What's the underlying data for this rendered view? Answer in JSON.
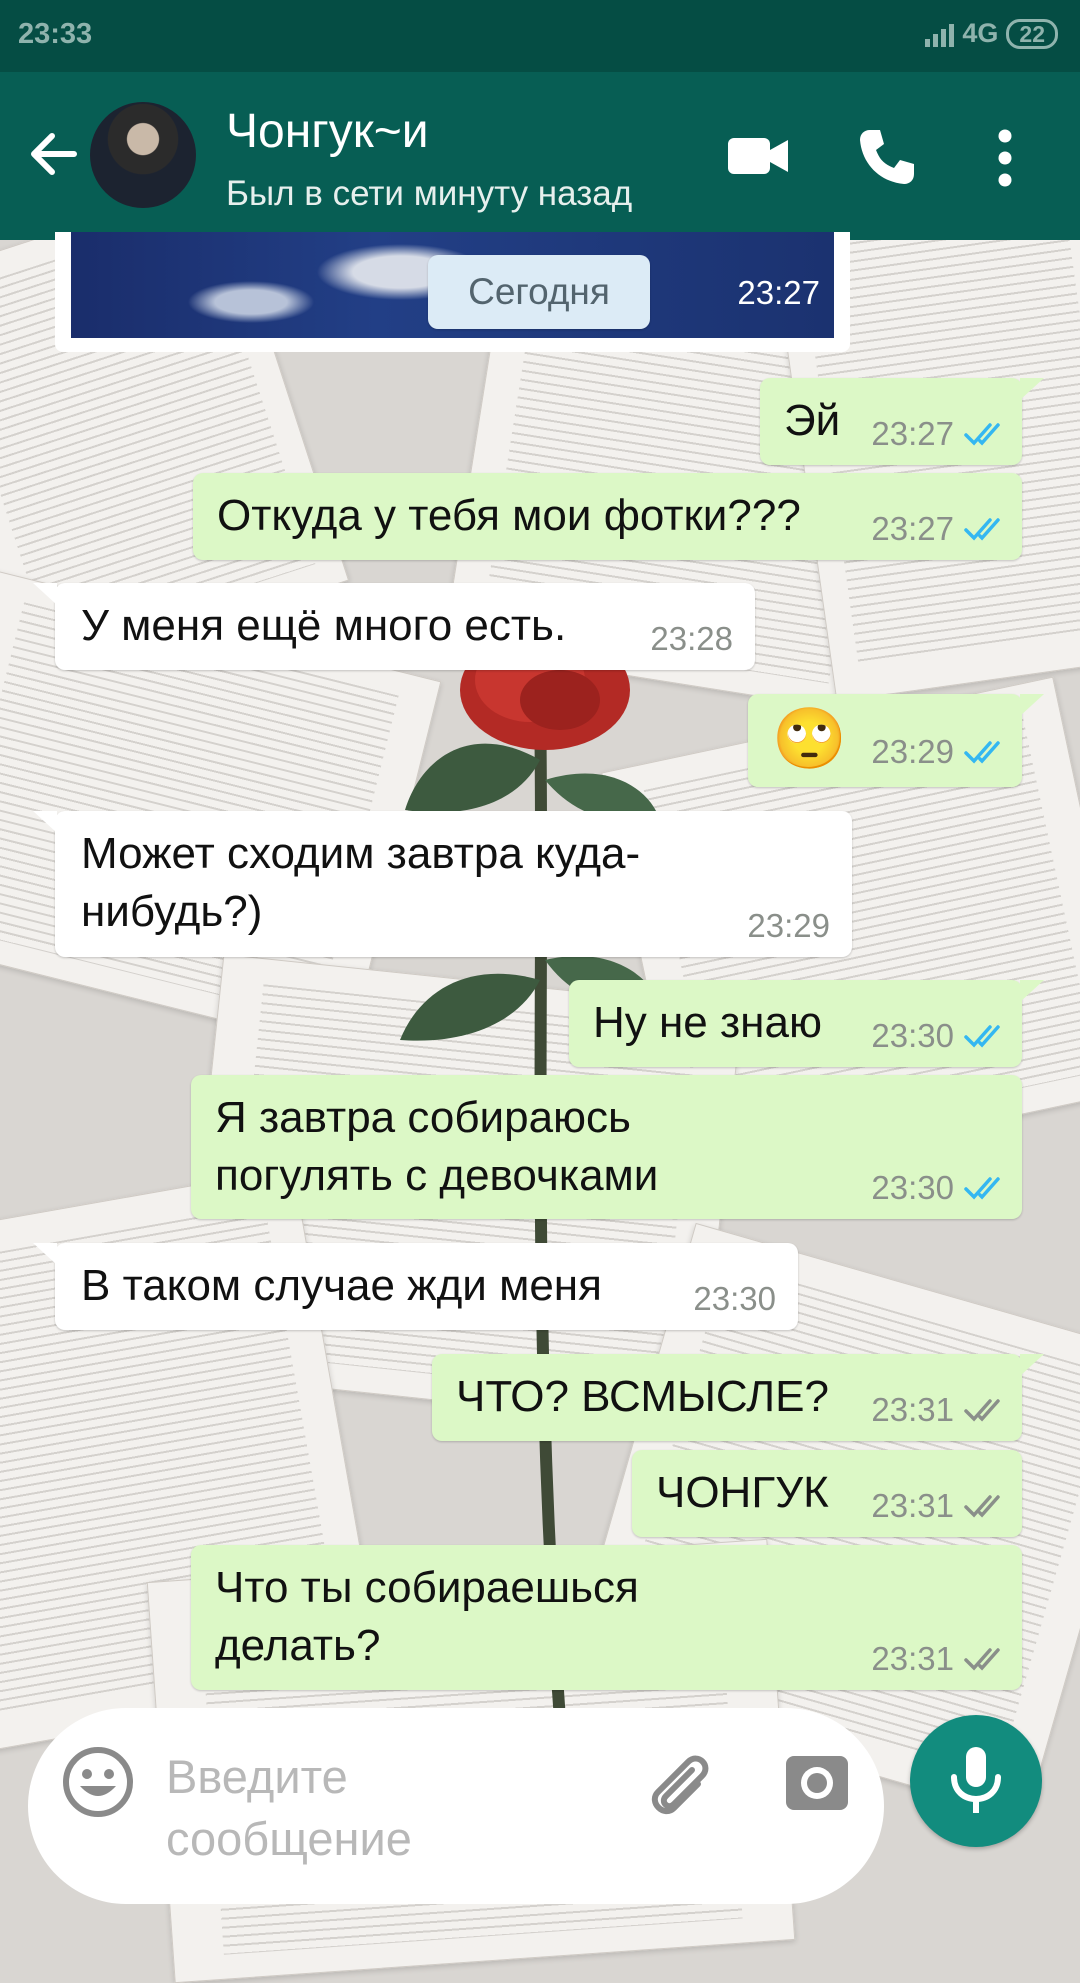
{
  "status_bar": {
    "time": "23:33",
    "network": "4G",
    "battery": "22"
  },
  "header": {
    "contact_name": "Чонгук~и",
    "contact_status": "Был в сети минуту назад"
  },
  "image_message": {
    "time": "23:27"
  },
  "date_chip": "Сегодня",
  "messages": [
    {
      "text": "Эй",
      "time": "23:27",
      "direction": "out",
      "status": "read"
    },
    {
      "text": "Откуда у тебя мои фотки???",
      "time": "23:27",
      "direction": "out",
      "status": "read"
    },
    {
      "text": "У меня ещё много есть.",
      "time": "23:28",
      "direction": "in"
    },
    {
      "text": "🙄",
      "time": "23:29",
      "direction": "out",
      "status": "read"
    },
    {
      "text": "Может сходим завтра куда-\nнибудь?)",
      "time": "23:29",
      "direction": "in"
    },
    {
      "text": "Ну не знаю",
      "time": "23:30",
      "direction": "out",
      "status": "read"
    },
    {
      "text": "Я завтра собираюсь\nпогулять с девочками",
      "time": "23:30",
      "direction": "out",
      "status": "read"
    },
    {
      "text": "В таком случае жди меня",
      "time": "23:30",
      "direction": "in"
    },
    {
      "text": "ЧТО? ВСМЫСЛЕ?",
      "time": "23:31",
      "direction": "out",
      "status": "delivered"
    },
    {
      "text": "ЧОНГУК",
      "time": "23:31",
      "direction": "out",
      "status": "delivered"
    },
    {
      "text": "Что ты собираешься\nделать?",
      "time": "23:31",
      "direction": "out",
      "status": "delivered"
    }
  ],
  "input": {
    "placeholder": "Введите\nсообщение"
  },
  "colors": {
    "header": "#075e54",
    "status_bar": "#054d44",
    "outgoing_bubble": "#dcf8c6",
    "incoming_bubble": "#ffffff",
    "read_ticks": "#34b7f1",
    "delivered_ticks": "#8a8f8a",
    "mic_button": "#128c7e"
  },
  "icons": {
    "back": "arrow-left-icon",
    "video": "video-camera-icon",
    "call": "phone-icon",
    "menu": "more-vertical-icon",
    "emoji": "smiley-icon",
    "attach": "paperclip-icon",
    "camera": "camera-icon",
    "mic": "microphone-icon"
  }
}
